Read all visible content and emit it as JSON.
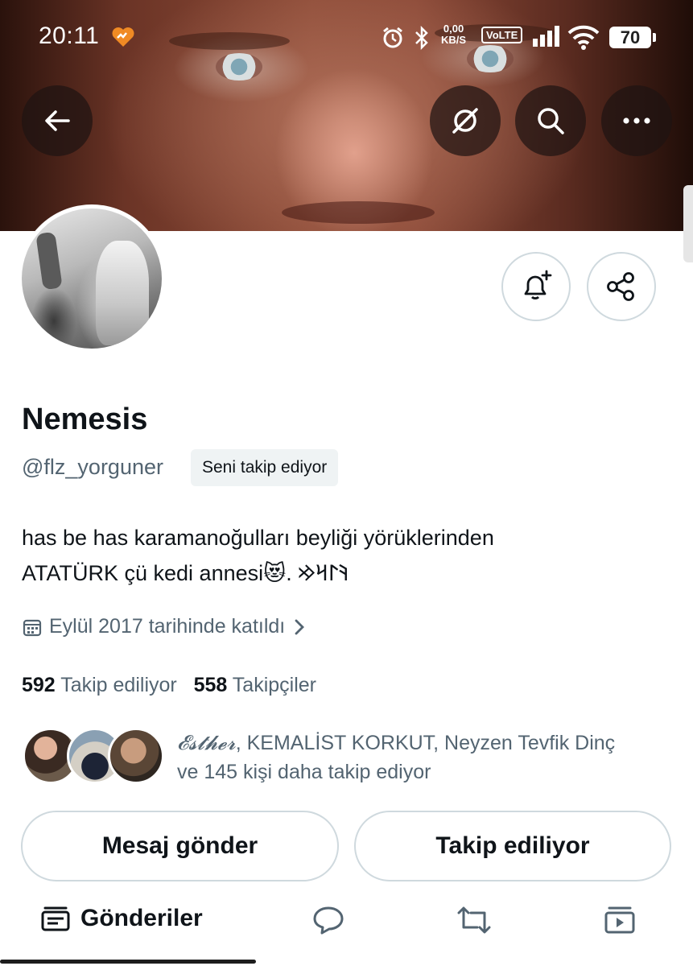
{
  "status_bar": {
    "time": "20:11",
    "net_speed_value": "0,00",
    "net_speed_unit": "KB/S",
    "volte": "VoLTE",
    "battery": "70"
  },
  "profile": {
    "name": "Nemesis",
    "handle": "@flz_yorguner",
    "follows_you_badge": "Seni takip ediyor",
    "bio_line1": "has be has karamanoğulları beyliği yörüklerinden",
    "bio_line2": "ATATÜRK çü kedi annesi😻. 𐰚𐰃𐰺𐰢",
    "joined": "Eylül 2017 tarihinde katıldı",
    "following_count": "592",
    "following_label": "Takip ediliyor",
    "followers_count": "558",
    "followers_label": "Takipçiler",
    "mutual_name1": "𝓔𝓼𝓽𝓱𝓮𝓻",
    "mutual_rest": ", KEMALİST KORKUT, Neyzen Tevfik Dinç",
    "mutual_line2": "ve 145 kişi daha takip ediyor"
  },
  "actions": {
    "message_button": "Mesaj gönder",
    "following_button": "Takip ediliyor"
  },
  "tabs": {
    "posts": "Gönderiler"
  },
  "icons": [
    "back-arrow-icon",
    "no-translate-icon",
    "search-icon",
    "more-icon",
    "bell-plus-icon",
    "share-icon",
    "calendar-icon",
    "chevron-right-icon",
    "posts-icon",
    "reply-icon",
    "retweet-icon",
    "media-icon"
  ]
}
